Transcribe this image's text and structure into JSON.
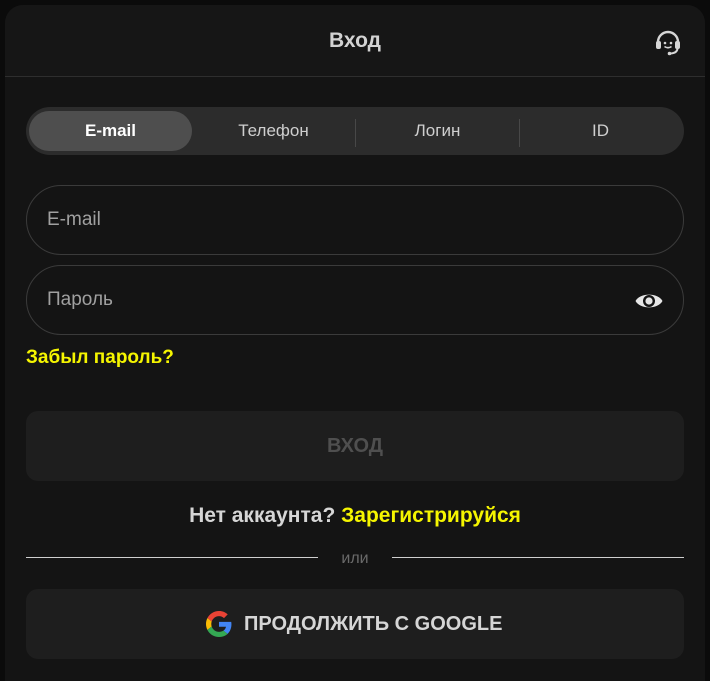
{
  "header": {
    "title": "Вход",
    "support_icon": "headset-support-icon"
  },
  "tabs": [
    {
      "label": "E-mail",
      "active": true
    },
    {
      "label": "Телефон",
      "active": false
    },
    {
      "label": "Логин",
      "active": false
    },
    {
      "label": "ID",
      "active": false
    }
  ],
  "form": {
    "email_placeholder": "E-mail",
    "email_value": "",
    "password_placeholder": "Пароль",
    "password_value": "",
    "show_password_icon": "eye-icon",
    "forgot_label": "Забыл пароль?",
    "submit_label": "ВХОД"
  },
  "register": {
    "prompt": "Нет аккаунта?",
    "link": "Зарегистрируйся"
  },
  "divider": {
    "label": "или"
  },
  "google": {
    "label": "ПРОДОЛЖИТЬ С GOOGLE",
    "icon": "google-logo-icon"
  },
  "colors": {
    "background": "#141414",
    "accent": "#f5f500",
    "tab_active": "#4e4e4e",
    "tab_bar": "#2c2c2c",
    "button_bg": "#1e1e1e"
  }
}
